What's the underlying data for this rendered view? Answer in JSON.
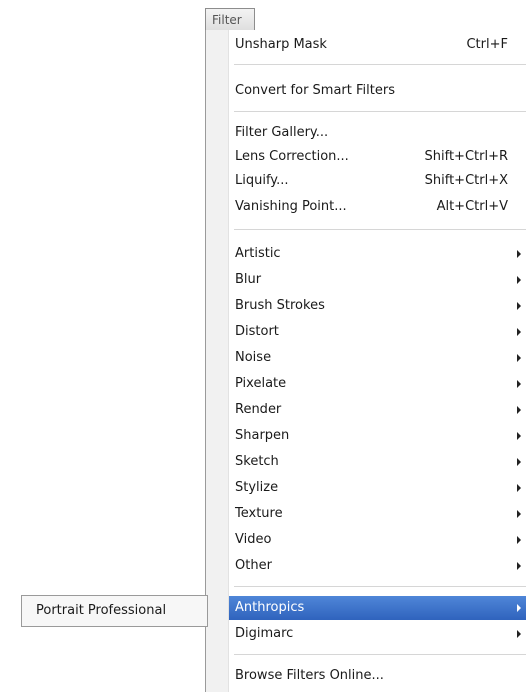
{
  "menubar": {
    "filter_label": "Filter"
  },
  "filter_menu": {
    "unsharp_mask": {
      "label": "Unsharp Mask",
      "shortcut": "Ctrl+F"
    },
    "convert_smart": {
      "label": "Convert for Smart Filters"
    },
    "filter_gallery": {
      "label": "Filter Gallery..."
    },
    "lens_correction": {
      "label": "Lens Correction...",
      "shortcut": "Shift+Ctrl+R"
    },
    "liquify": {
      "label": "Liquify...",
      "shortcut": "Shift+Ctrl+X"
    },
    "vanishing_point": {
      "label": "Vanishing Point...",
      "shortcut": "Alt+Ctrl+V"
    },
    "submenus": [
      {
        "label": "Artistic"
      },
      {
        "label": "Blur"
      },
      {
        "label": "Brush Strokes"
      },
      {
        "label": "Distort"
      },
      {
        "label": "Noise"
      },
      {
        "label": "Pixelate"
      },
      {
        "label": "Render"
      },
      {
        "label": "Sharpen"
      },
      {
        "label": "Sketch"
      },
      {
        "label": "Stylize"
      },
      {
        "label": "Texture"
      },
      {
        "label": "Video"
      },
      {
        "label": "Other"
      }
    ],
    "plugins": [
      {
        "label": "Anthropics",
        "selected": true
      },
      {
        "label": "Digimarc"
      }
    ],
    "browse_online": {
      "label": "Browse Filters Online..."
    }
  },
  "anthropics_submenu": {
    "items": [
      {
        "label": "Portrait Professional"
      }
    ]
  },
  "colors": {
    "selection": "#3a70c9",
    "menu_background": "#ffffff",
    "gutter": "#f1f1f1"
  }
}
